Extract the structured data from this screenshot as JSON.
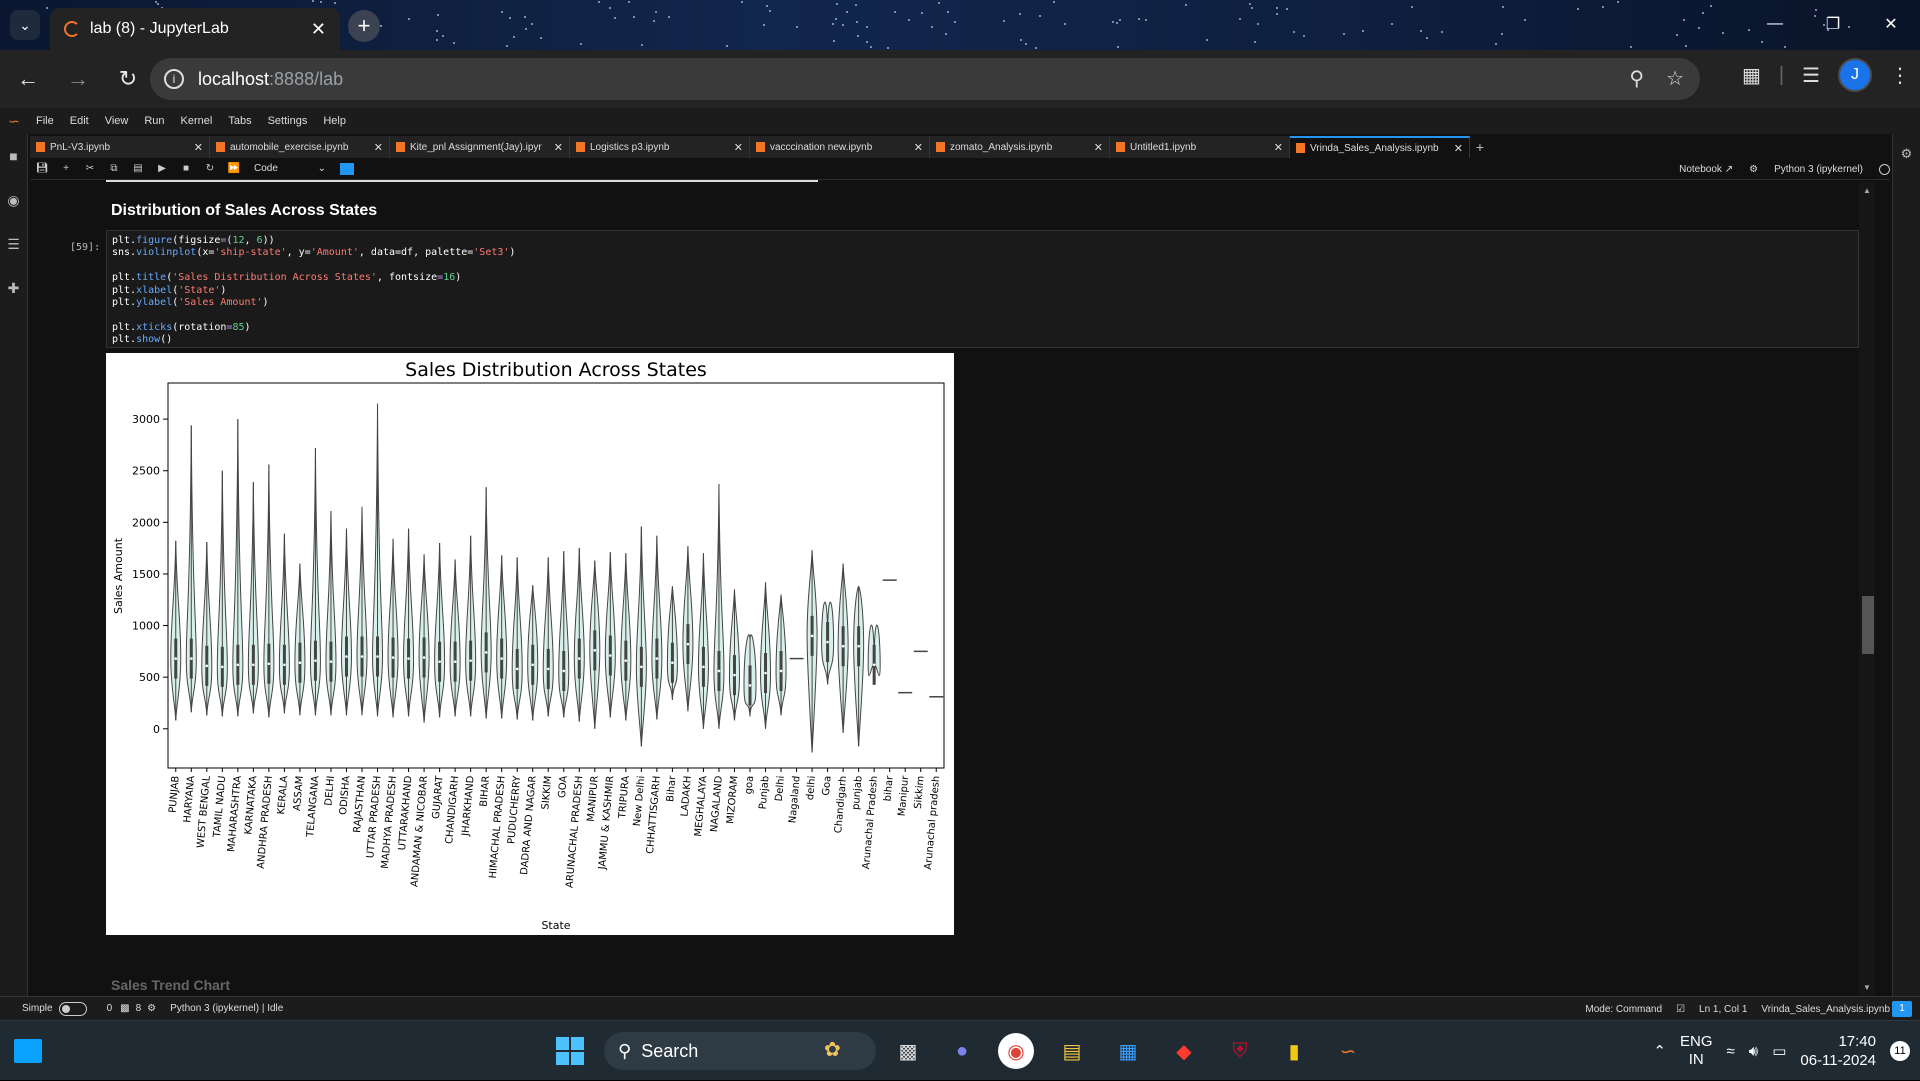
{
  "browser": {
    "tab_title": "lab (8) - JupyterLab",
    "url_host": "localhost",
    "url_path": ":8888/lab",
    "profile_initial": "J"
  },
  "jupyter": {
    "menu": [
      "File",
      "Edit",
      "View",
      "Run",
      "Kernel",
      "Tabs",
      "Settings",
      "Help"
    ],
    "doc_tabs": [
      {
        "label": "PnL-V3.ipynb"
      },
      {
        "label": "automobile_exercise.ipynb"
      },
      {
        "label": "Kite_pnl Assignment(Jay).ipyr"
      },
      {
        "label": "Logistics p3.ipynb"
      },
      {
        "label": "vacccination new.ipynb"
      },
      {
        "label": "zomato_Analysis.ipynb"
      },
      {
        "label": "Untitled1.ipynb"
      },
      {
        "label": "Vrinda_Sales_Analysis.ipynb"
      }
    ],
    "cell_type": "Code",
    "notebook_label": "Notebook",
    "kernel_label": "Python 3 (ipykernel)",
    "section_heading": "Distribution of Sales Across States",
    "prompt": "[59]:",
    "code_lines": [
      "plt.figure(figsize=(12, 6))",
      "sns.violinplot(x='ship-state', y='Amount', data=df, palette='Set3')",
      "",
      "plt.title('Sales Distribution Across States', fontsize=16)",
      "plt.xlabel('State')",
      "plt.ylabel('Sales Amount')",
      "",
      "plt.xticks(rotation=85)",
      "plt.show()"
    ],
    "next_heading_partial": "Sales Trend Chart"
  },
  "status": {
    "mode_toggle": "Simple",
    "count_a": "0",
    "count_b": "8",
    "kernel_status": "Python 3 (ipykernel) | Idle",
    "mode": "Mode: Command",
    "cursor": "Ln 1, Col 1",
    "file": "Vrinda_Sales_Analysis.ipynb",
    "notifications": "1"
  },
  "taskbar": {
    "search_placeholder": "Search",
    "lang_top": "ENG",
    "lang_bottom": "IN",
    "time": "17:40",
    "date": "06-11-2024",
    "notif_badge": "11"
  },
  "chart_data": {
    "type": "violin",
    "title": "Sales Distribution Across States",
    "xlabel": "State",
    "ylabel": "Sales Amount",
    "ylim": [
      -380,
      3350
    ],
    "yticks": [
      0,
      500,
      1000,
      1500,
      2000,
      2500,
      3000
    ],
    "categories": [
      "PUNJAB",
      "HARYANA",
      "WEST BENGAL",
      "TAMIL NADU",
      "MAHARASHTRA",
      "KARNATAKA",
      "ANDHRA PRADESH",
      "KERALA",
      "ASSAM",
      "TELANGANA",
      "DELHI",
      "ODISHA",
      "RAJASTHAN",
      "UTTAR PRADESH",
      "MADHYA PRADESH",
      "UTTARAKHAND",
      "ANDAMAN & NICOBAR",
      "GUJARAT",
      "CHANDIGARH",
      "JHARKHAND",
      "BIHAR",
      "HIMACHAL PRADESH",
      "PUDUCHERRY",
      "DADRA AND NAGAR",
      "SIKKIM",
      "GOA",
      "ARUNACHAL PRADESH",
      "MANIPUR",
      "JAMMU & KASHMIR",
      "TRIPURA",
      "New Delhi",
      "CHHATTISGARH",
      "Bihar",
      "LADAKH",
      "MEGHALAYA",
      "NAGALAND",
      "MIZORAM",
      "goa",
      "Punjab",
      "Delhi",
      "Nagaland",
      "delhi",
      "Goa",
      "Chandigarh",
      "punjab",
      "Arunachal Pradesh",
      "bihar",
      "Manipur",
      "Sikkim",
      "Arunachal pradesh"
    ],
    "values_min": [
      80,
      160,
      130,
      120,
      120,
      150,
      110,
      150,
      130,
      130,
      130,
      130,
      130,
      120,
      110,
      120,
      60,
      110,
      120,
      120,
      100,
      100,
      90,
      80,
      120,
      110,
      70,
      0,
      110,
      80,
      -170,
      90,
      280,
      170,
      0,
      0,
      80,
      120,
      0,
      130,
      680,
      -230,
      430,
      -40,
      -170,
      560,
      1440,
      350,
      750,
      310
    ],
    "values_median": [
      680,
      680,
      610,
      600,
      620,
      620,
      630,
      620,
      640,
      660,
      650,
      700,
      700,
      700,
      690,
      680,
      690,
      650,
      650,
      660,
      740,
      680,
      580,
      620,
      580,
      560,
      680,
      760,
      710,
      660,
      600,
      680,
      640,
      820,
      600,
      560,
      520,
      420,
      540,
      560,
      680,
      900,
      840,
      800,
      800,
      620,
      1440,
      350,
      750,
      310
    ],
    "values_max": [
      1820,
      2940,
      1810,
      2500,
      3000,
      2390,
      2560,
      1890,
      1600,
      2720,
      2110,
      1940,
      2150,
      3150,
      1840,
      1940,
      1690,
      1800,
      1640,
      1870,
      2340,
      1680,
      1660,
      1390,
      1660,
      1720,
      1750,
      1630,
      1710,
      1700,
      1960,
      1870,
      1380,
      1770,
      1700,
      2370,
      1350,
      870,
      1420,
      1300,
      680,
      1730,
      950,
      1600,
      1380,
      720,
      1440,
      350,
      750,
      310
    ]
  }
}
